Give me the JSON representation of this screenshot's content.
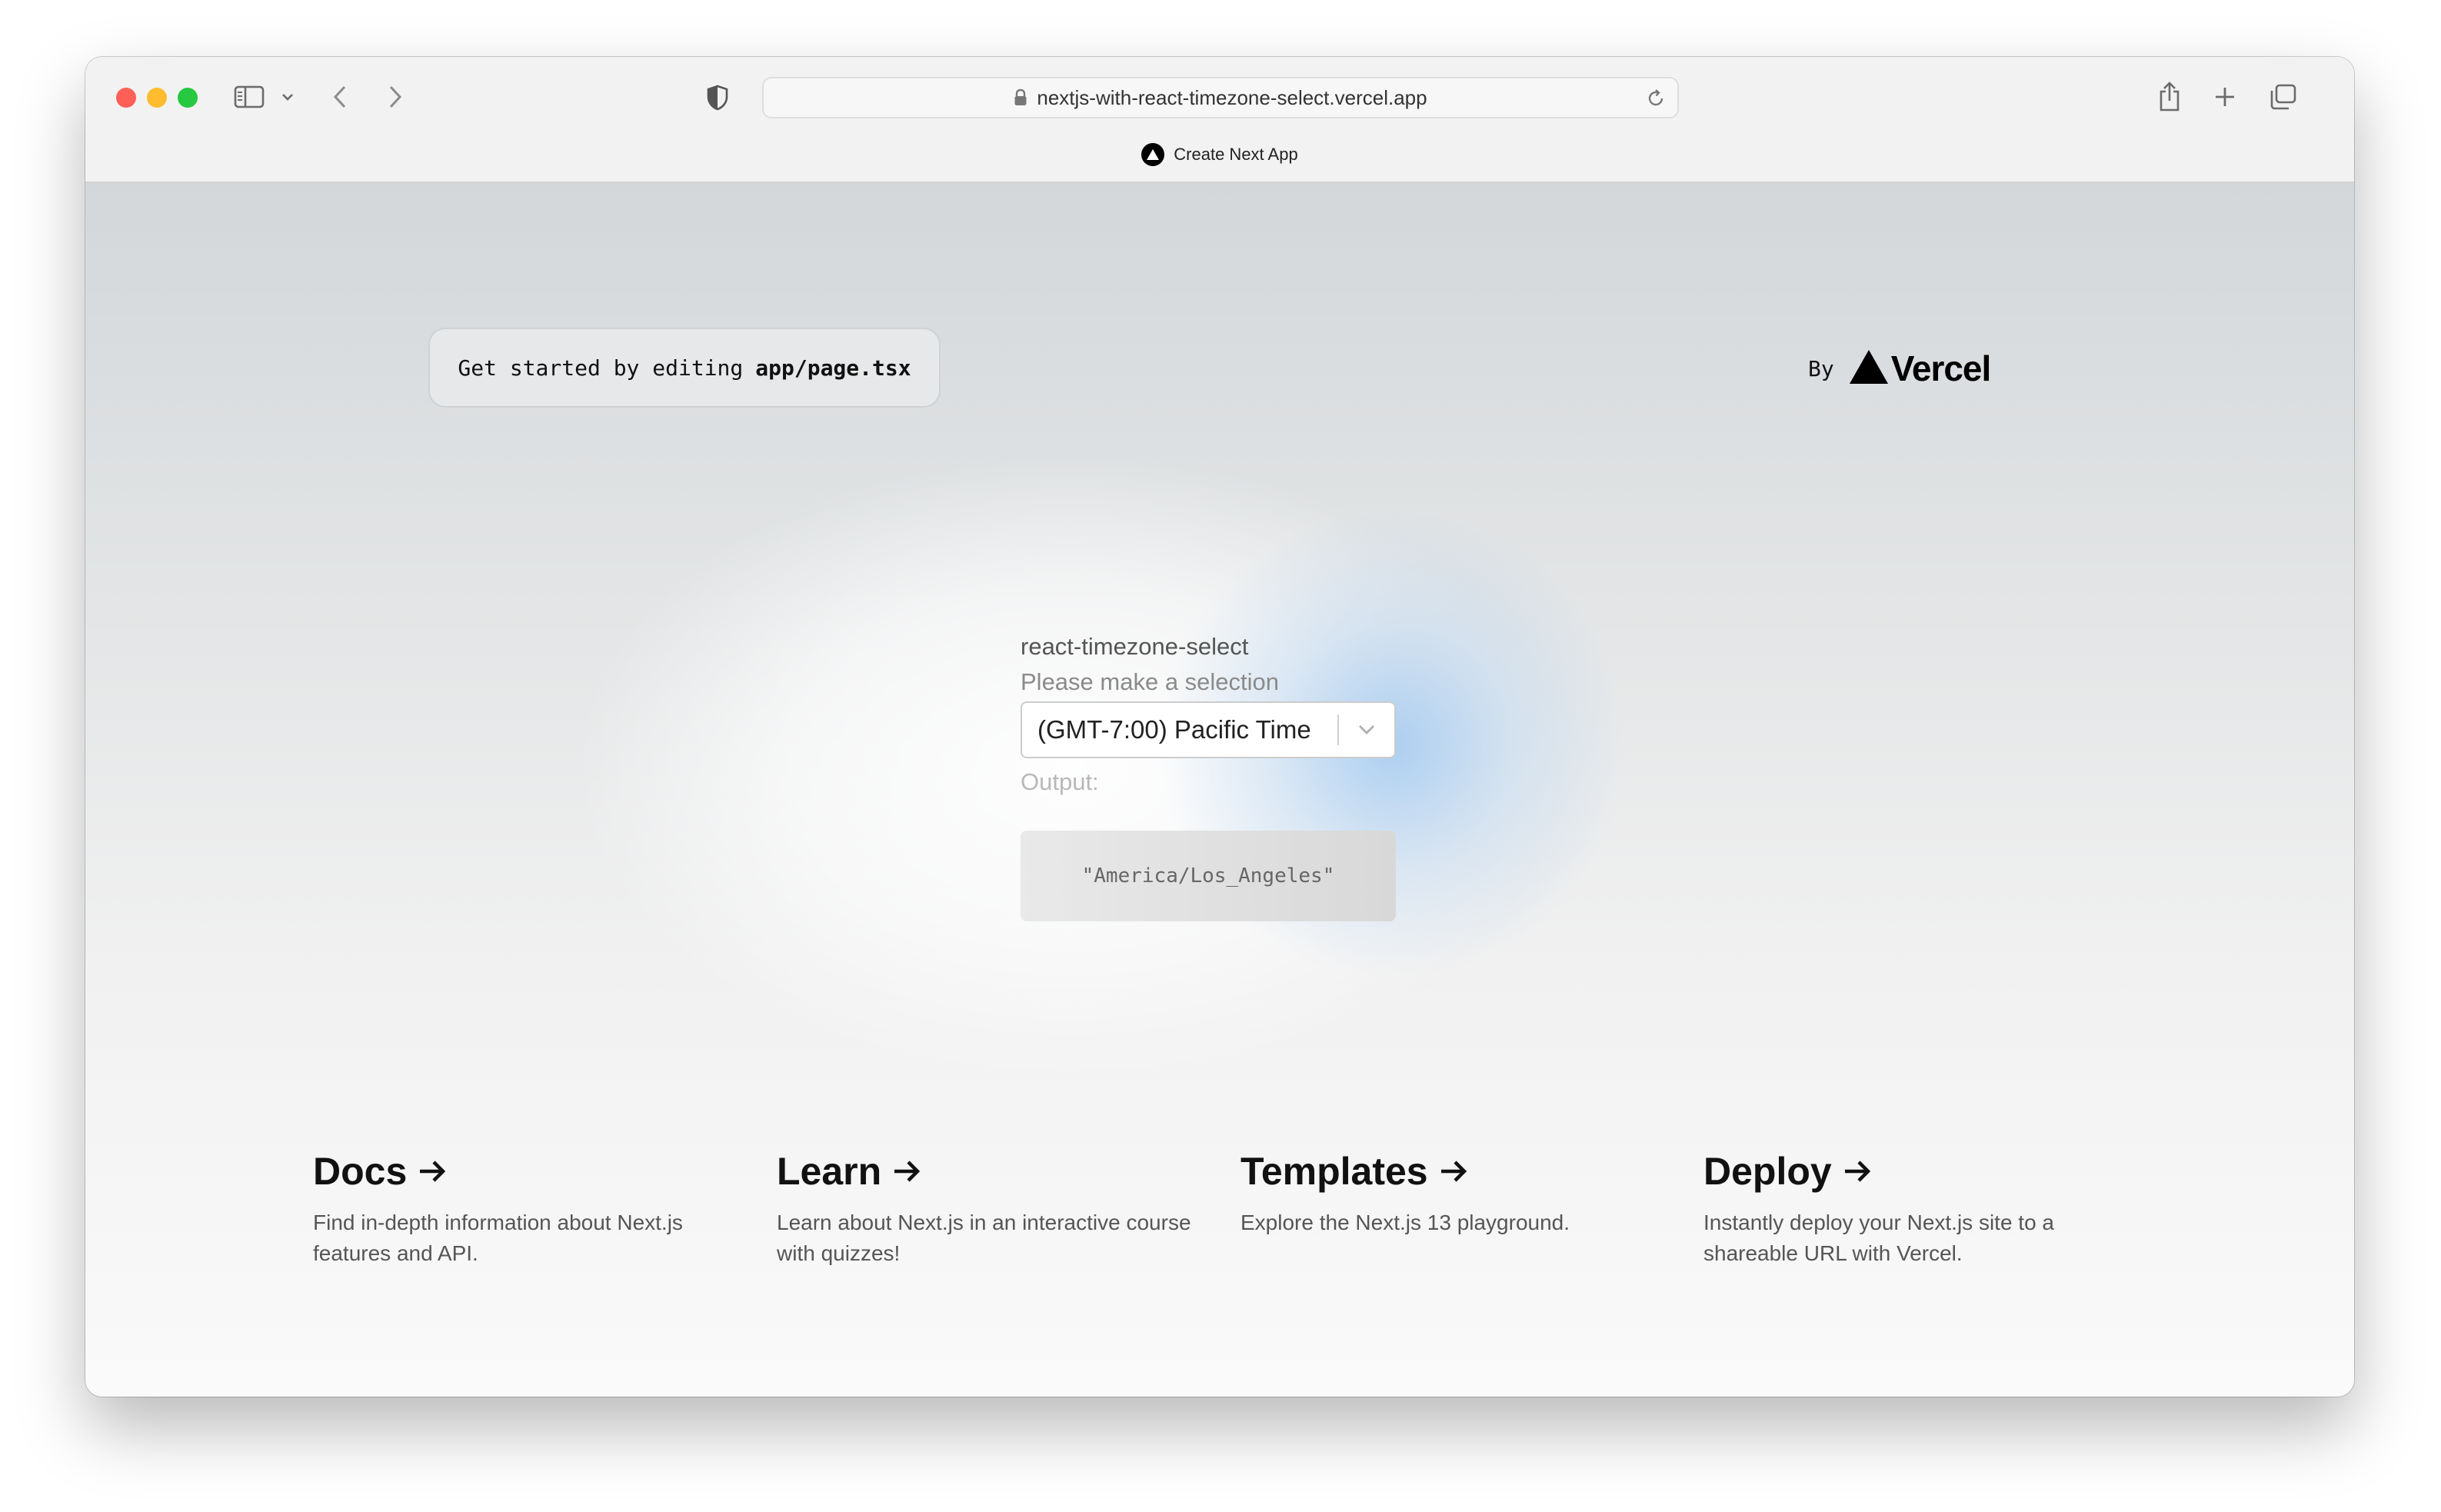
{
  "browser": {
    "url": "nextjs-with-react-timezone-select.vercel.app",
    "tab_title": "Create Next App"
  },
  "header": {
    "code_prefix": "Get started by editing",
    "code_file": "app/page.tsx",
    "by_label": "By",
    "brand": "Vercel"
  },
  "timezone": {
    "title": "react-timezone-select",
    "subtitle": "Please make a selection",
    "selected": "(GMT-7:00) Pacific Time",
    "output_label": "Output:",
    "output_value": "\"America/Los_Angeles\""
  },
  "cards": [
    {
      "title": "Docs",
      "description": "Find in-depth information about Next.js features and API."
    },
    {
      "title": "Learn",
      "description": "Learn about Next.js in an interactive course with quizzes!"
    },
    {
      "title": "Templates",
      "description": "Explore the Next.js 13 playground."
    },
    {
      "title": "Deploy",
      "description": "Instantly deploy your Next.js site to a shareable URL with Vercel."
    }
  ],
  "colors": {
    "traffic_red": "#fe5f57",
    "traffic_yellow": "#febc2e",
    "traffic_green": "#28c840",
    "glow_blue": "#a0c8f0"
  }
}
